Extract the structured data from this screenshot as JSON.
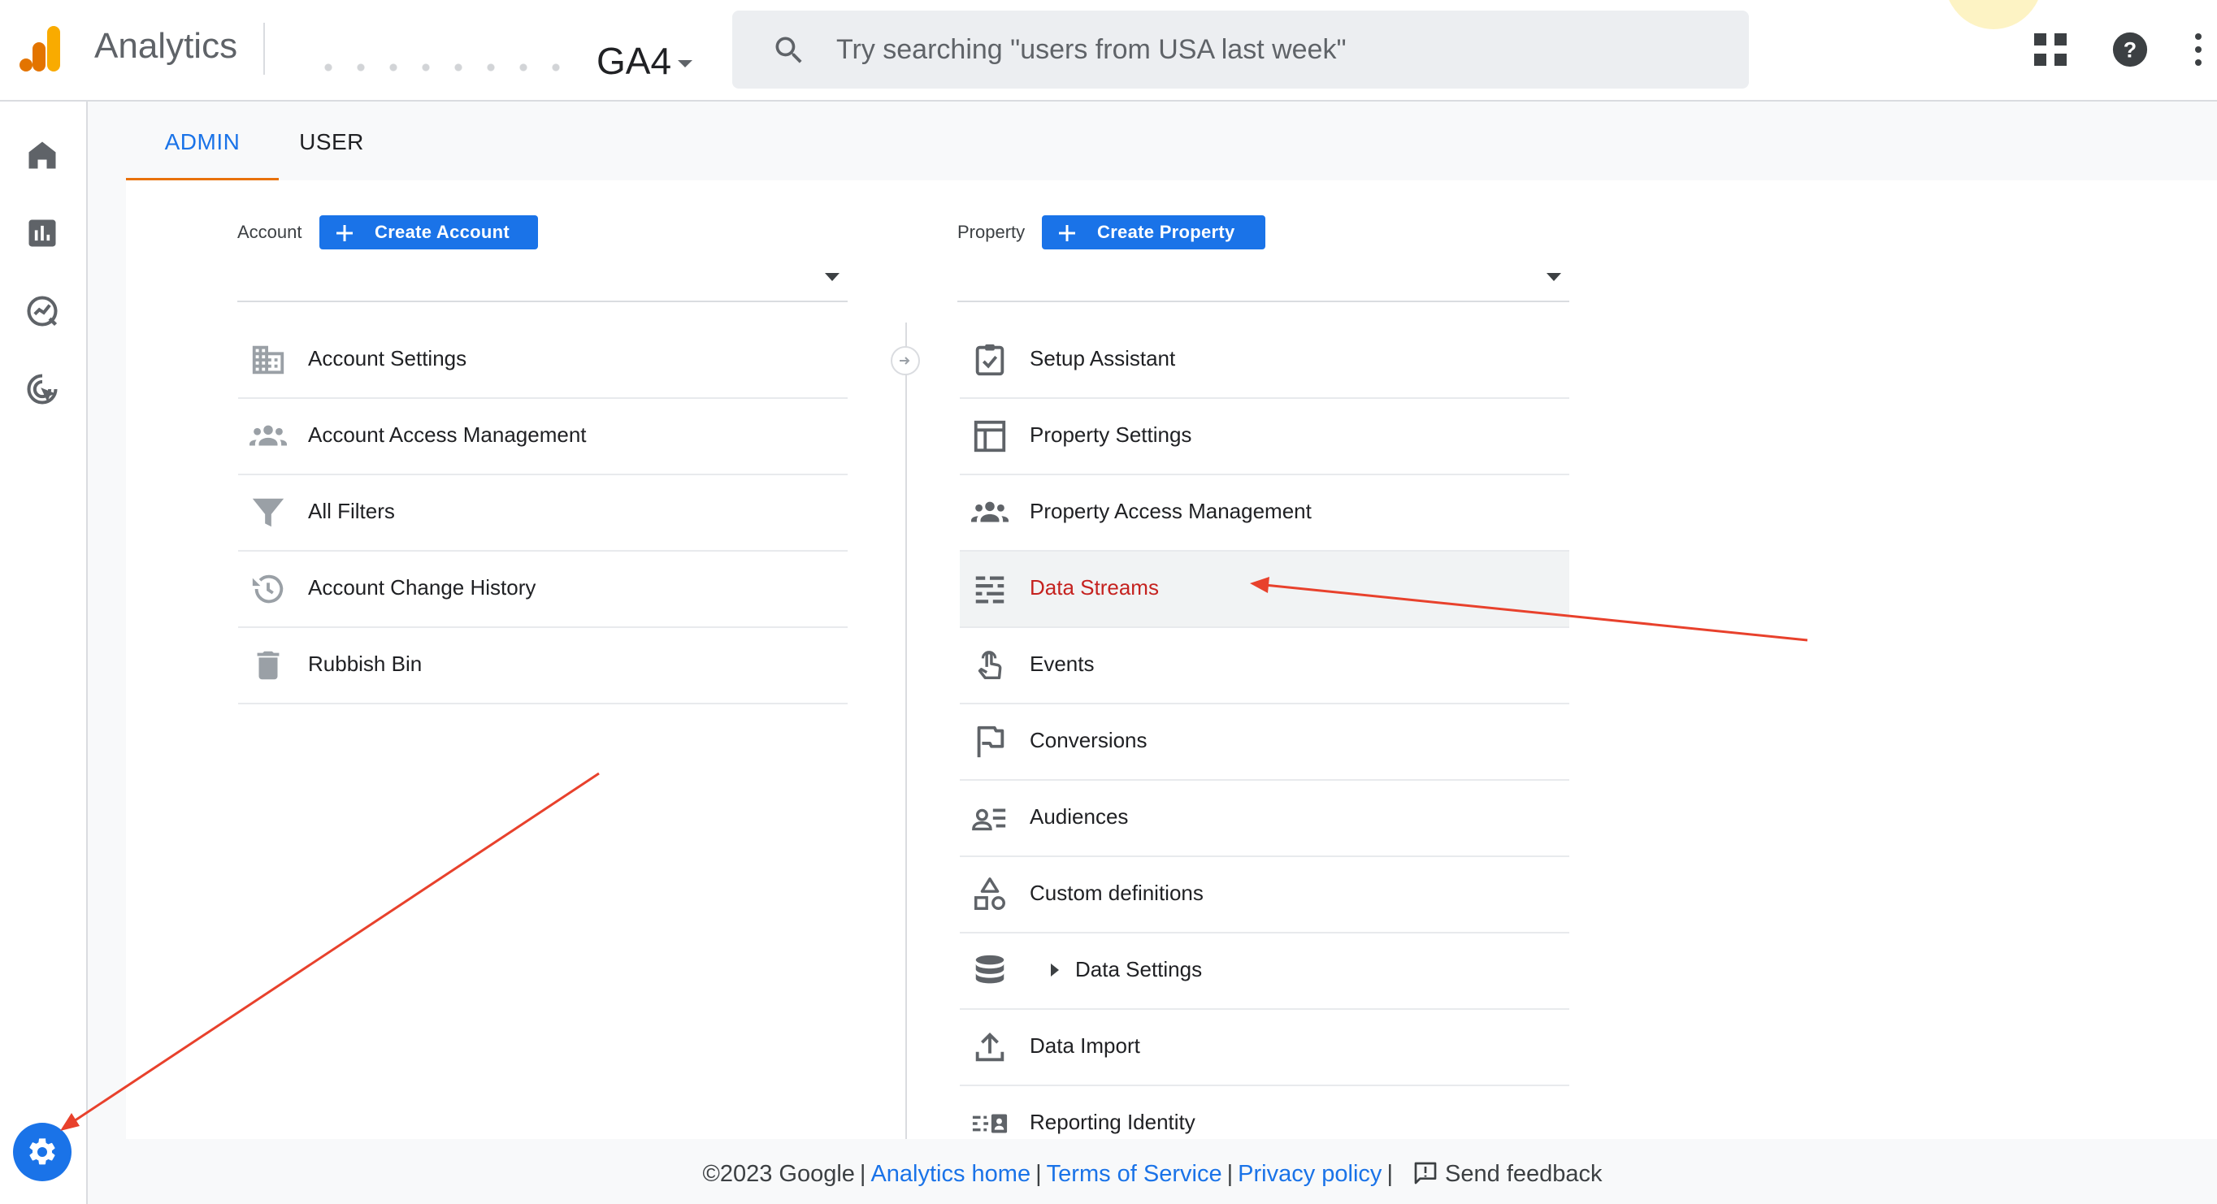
{
  "app": {
    "title": "Analytics",
    "property_suffix": "GA4",
    "colors": {
      "accent": "#1a73e8",
      "tab_underline": "#e8710a",
      "highlight": "#c5221f",
      "logo_orange": "#f9ab00",
      "logo_dark": "#e37400"
    }
  },
  "search": {
    "placeholder": "Try searching \"users from USA last week\"",
    "icon": "search-icon"
  },
  "header_icons": [
    "apps-grid-icon",
    "help-icon",
    "more-vert-icon"
  ],
  "rail": {
    "items": [
      "home-icon",
      "reports-icon",
      "explore-icon",
      "advertising-icon"
    ],
    "settings": "settings-icon"
  },
  "tabs": [
    {
      "label": "ADMIN",
      "active": true
    },
    {
      "label": "USER",
      "active": false
    }
  ],
  "account": {
    "label": "Account",
    "create_label": "Create Account",
    "items": [
      {
        "label": "Account Settings",
        "icon": "building-icon"
      },
      {
        "label": "Account Access Management",
        "icon": "people-icon"
      },
      {
        "label": "All Filters",
        "icon": "filter-icon"
      },
      {
        "label": "Account Change History",
        "icon": "history-icon"
      },
      {
        "label": "Rubbish Bin",
        "icon": "trash-icon"
      }
    ]
  },
  "property": {
    "label": "Property",
    "create_label": "Create Property",
    "items": [
      {
        "label": "Setup Assistant",
        "icon": "checklist-icon"
      },
      {
        "label": "Property Settings",
        "icon": "property-settings-icon"
      },
      {
        "label": "Property Access Management",
        "icon": "people-icon"
      },
      {
        "label": "Data Streams",
        "icon": "data-streams-icon",
        "active": true
      },
      {
        "label": "Events",
        "icon": "touch-icon"
      },
      {
        "label": "Conversions",
        "icon": "flag-icon"
      },
      {
        "label": "Audiences",
        "icon": "audiences-icon"
      },
      {
        "label": "Custom definitions",
        "icon": "shapes-icon"
      },
      {
        "label": "Data Settings",
        "icon": "database-icon",
        "expandable": true
      },
      {
        "label": "Data Import",
        "icon": "upload-icon"
      },
      {
        "label": "Reporting Identity",
        "icon": "reporting-identity-icon"
      }
    ]
  },
  "footer": {
    "copyright": "©2023 Google",
    "links": [
      "Analytics home",
      "Terms of Service",
      "Privacy policy"
    ],
    "feedback": "Send feedback"
  }
}
